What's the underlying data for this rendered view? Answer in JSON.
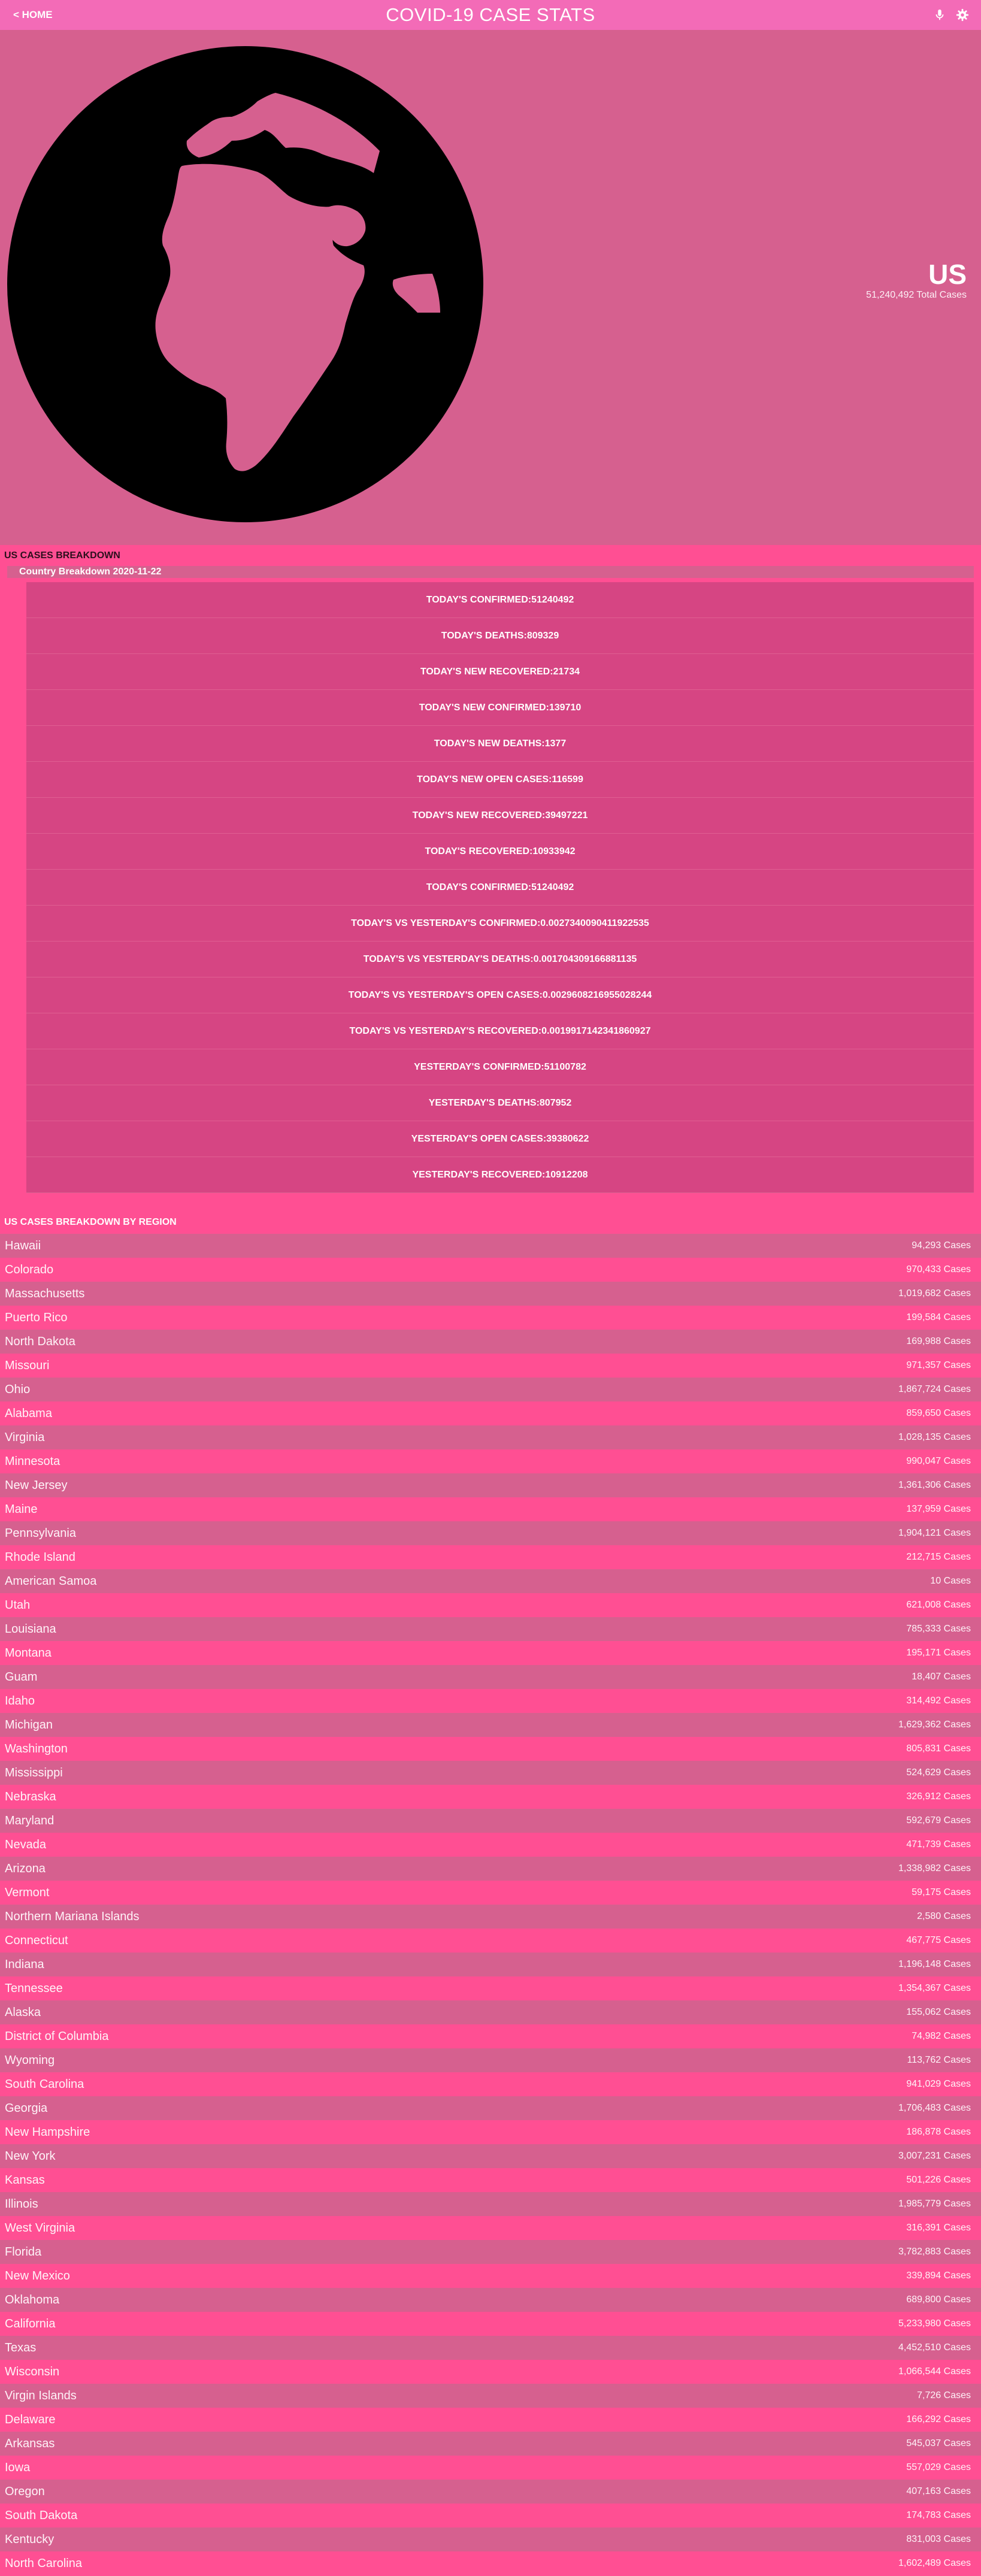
{
  "nav": {
    "back_label": "< HOME",
    "title": "COVID-19 CASE STATS"
  },
  "hero": {
    "country": "US",
    "total_cases": "51,240,492 Total Cases"
  },
  "breakdown": {
    "title": "US CASES BREAKDOWN",
    "country_label": "Country Breakdown 2020-11-22",
    "stats": [
      "TODAY'S CONFIRMED:51240492",
      "TODAY'S DEATHS:809329",
      "TODAY'S NEW RECOVERED:21734",
      "TODAY'S NEW CONFIRMED:139710",
      "TODAY'S NEW DEATHS:1377",
      "TODAY'S NEW OPEN CASES:116599",
      "TODAY'S NEW RECOVERED:39497221",
      "TODAY'S RECOVERED:10933942",
      "TODAY'S CONFIRMED:51240492",
      "TODAY'S VS YESTERDAY'S CONFIRMED:0.0027340090411922535",
      "TODAY'S VS YESTERDAY'S DEATHS:0.001704309166881135",
      "TODAY'S VS YESTERDAY'S OPEN CASES:0.0029608216955028244",
      "TODAY'S VS YESTERDAY'S RECOVERED:0.0019917142341860927",
      "YESTERDAY'S CONFIRMED:51100782",
      "YESTERDAY'S DEATHS:807952",
      "YESTERDAY'S OPEN CASES:39380622",
      "YESTERDAY'S RECOVERED:10912208"
    ]
  },
  "regions": {
    "title": "US CASES BREAKDOWN BY REGION",
    "items": [
      {
        "name": "Hawaii",
        "cases": "94,293 Cases"
      },
      {
        "name": "Colorado",
        "cases": "970,433 Cases"
      },
      {
        "name": "Massachusetts",
        "cases": "1,019,682 Cases"
      },
      {
        "name": "Puerto Rico",
        "cases": "199,584 Cases"
      },
      {
        "name": "North Dakota",
        "cases": "169,988 Cases"
      },
      {
        "name": "Missouri",
        "cases": "971,357 Cases"
      },
      {
        "name": "Ohio",
        "cases": "1,867,724 Cases"
      },
      {
        "name": "Alabama",
        "cases": "859,650 Cases"
      },
      {
        "name": "Virginia",
        "cases": "1,028,135 Cases"
      },
      {
        "name": "Minnesota",
        "cases": "990,047 Cases"
      },
      {
        "name": "New Jersey",
        "cases": "1,361,306 Cases"
      },
      {
        "name": "Maine",
        "cases": "137,959 Cases"
      },
      {
        "name": "Pennsylvania",
        "cases": "1,904,121 Cases"
      },
      {
        "name": "Rhode Island",
        "cases": "212,715 Cases"
      },
      {
        "name": "American Samoa",
        "cases": "10 Cases"
      },
      {
        "name": "Utah",
        "cases": "621,008 Cases"
      },
      {
        "name": "Louisiana",
        "cases": "785,333 Cases"
      },
      {
        "name": "Montana",
        "cases": "195,171 Cases"
      },
      {
        "name": "Guam",
        "cases": "18,407 Cases"
      },
      {
        "name": "Idaho",
        "cases": "314,492 Cases"
      },
      {
        "name": "Michigan",
        "cases": "1,629,362 Cases"
      },
      {
        "name": "Washington",
        "cases": "805,831 Cases"
      },
      {
        "name": "Mississippi",
        "cases": "524,629 Cases"
      },
      {
        "name": "Nebraska",
        "cases": "326,912 Cases"
      },
      {
        "name": "Maryland",
        "cases": "592,679 Cases"
      },
      {
        "name": "Nevada",
        "cases": "471,739 Cases"
      },
      {
        "name": "Arizona",
        "cases": "1,338,982 Cases"
      },
      {
        "name": "Vermont",
        "cases": "59,175 Cases"
      },
      {
        "name": "Northern Mariana Islands",
        "cases": "2,580 Cases"
      },
      {
        "name": "Connecticut",
        "cases": "467,775 Cases"
      },
      {
        "name": "Indiana",
        "cases": "1,196,148 Cases"
      },
      {
        "name": "Tennessee",
        "cases": "1,354,367 Cases"
      },
      {
        "name": "Alaska",
        "cases": "155,062 Cases"
      },
      {
        "name": "District of Columbia",
        "cases": "74,982 Cases"
      },
      {
        "name": "Wyoming",
        "cases": "113,762 Cases"
      },
      {
        "name": "South Carolina",
        "cases": "941,029 Cases"
      },
      {
        "name": "Georgia",
        "cases": "1,706,483 Cases"
      },
      {
        "name": "New Hampshire",
        "cases": "186,878 Cases"
      },
      {
        "name": "New York",
        "cases": "3,007,231 Cases"
      },
      {
        "name": "Kansas",
        "cases": "501,226 Cases"
      },
      {
        "name": "Illinois",
        "cases": "1,985,779 Cases"
      },
      {
        "name": "West Virginia",
        "cases": "316,391 Cases"
      },
      {
        "name": "Florida",
        "cases": "3,782,883 Cases"
      },
      {
        "name": "New Mexico",
        "cases": "339,894 Cases"
      },
      {
        "name": "Oklahoma",
        "cases": "689,800 Cases"
      },
      {
        "name": "California",
        "cases": "5,233,980 Cases"
      },
      {
        "name": "Texas",
        "cases": "4,452,510 Cases"
      },
      {
        "name": "Wisconsin",
        "cases": "1,066,544 Cases"
      },
      {
        "name": "Virgin Islands",
        "cases": "7,726 Cases"
      },
      {
        "name": "Delaware",
        "cases": "166,292 Cases"
      },
      {
        "name": "Arkansas",
        "cases": "545,037 Cases"
      },
      {
        "name": "Iowa",
        "cases": "557,029 Cases"
      },
      {
        "name": "Oregon",
        "cases": "407,163 Cases"
      },
      {
        "name": "South Dakota",
        "cases": "174,783 Cases"
      },
      {
        "name": "Kentucky",
        "cases": "831,003 Cases"
      },
      {
        "name": "North Carolina",
        "cases": "1,602,489 Cases"
      }
    ]
  }
}
